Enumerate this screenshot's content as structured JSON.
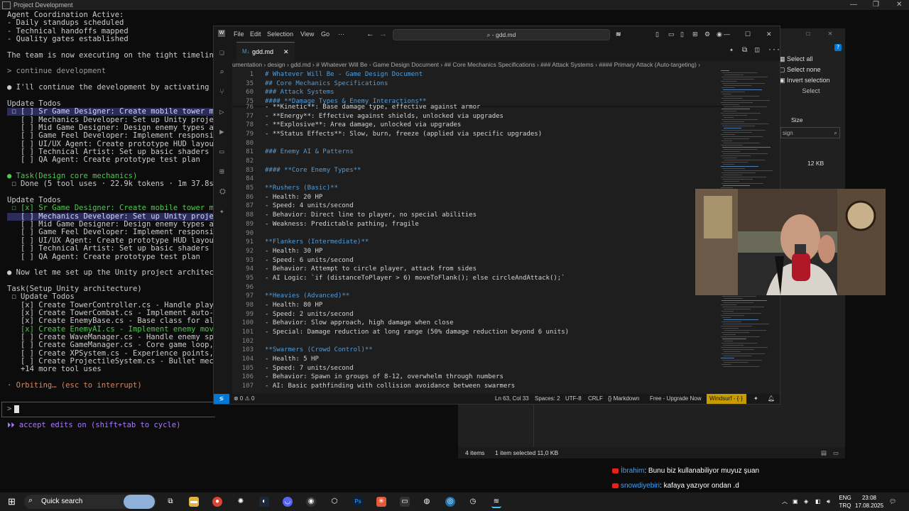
{
  "terminal": {
    "title": "Project Development",
    "lines": [
      {
        "t": "Agent Coordination Active:",
        "c": ""
      },
      {
        "t": "- Daily standups scheduled",
        "c": ""
      },
      {
        "t": "- Technical handoffs mapped",
        "c": ""
      },
      {
        "t": "- Quality gates established",
        "c": ""
      },
      {
        "t": "",
        "c": ""
      },
      {
        "t": "The team is now executing on the tight timeline with c",
        "c": ""
      },
      {
        "t": "",
        "c": ""
      },
      {
        "t": "> continue development",
        "c": "c-dim"
      },
      {
        "t": "",
        "c": ""
      },
      {
        "t": "● I'll continue the development by activating the key ag",
        "c": ""
      },
      {
        "t": "",
        "c": ""
      },
      {
        "t": "Update Todos",
        "c": ""
      },
      {
        "t": " ☐ [ ] Sr Game Designer: Create mobile tower mechanics",
        "c": "c-hl"
      },
      {
        "t": "   [ ] Mechanics Developer: Set up Unity project archi",
        "c": ""
      },
      {
        "t": "   [ ] Mid Game Designer: Design enemy types and wave ",
        "c": ""
      },
      {
        "t": "   [ ] Game Feel Developer: Implement responsive tower",
        "c": ""
      },
      {
        "t": "   [ ] UI/UX Agent: Create prototype HUD layout",
        "c": ""
      },
      {
        "t": "   [ ] Technical Artist: Set up basic shaders and visu",
        "c": ""
      },
      {
        "t": "   [ ] QA Agent: Create prototype test plan",
        "c": ""
      },
      {
        "t": "",
        "c": ""
      },
      {
        "t": "● Task(Design core mechanics)",
        "c": "c-green"
      },
      {
        "t": " ☐ Done (5 tool uses · 22.9k tokens · 1m 37.8s)",
        "c": ""
      },
      {
        "t": "",
        "c": ""
      },
      {
        "t": "Update Todos",
        "c": ""
      },
      {
        "t": " ☐ [x] Sr Game Designer: Create mobile tower mechanics",
        "c": "c-green"
      },
      {
        "t": "   [ ] Mechanics Developer: Set up Unity project archi",
        "c": "c-hl"
      },
      {
        "t": "   [ ] Mid Game Designer: Design enemy types and wave ",
        "c": ""
      },
      {
        "t": "   [ ] Game Feel Developer: Implement responsive tower",
        "c": ""
      },
      {
        "t": "   [ ] UI/UX Agent: Create prototype HUD layout",
        "c": ""
      },
      {
        "t": "   [ ] Technical Artist: Set up basic shaders and visu",
        "c": ""
      },
      {
        "t": "   [ ] QA Agent: Create prototype test plan",
        "c": ""
      },
      {
        "t": "",
        "c": ""
      },
      {
        "t": "● Now let me set up the Unity project architecture:",
        "c": ""
      },
      {
        "t": "",
        "c": ""
      },
      {
        "t": "Task(Setup Unity architecture)",
        "c": ""
      },
      {
        "t": " ☐ Update Todos",
        "c": ""
      },
      {
        "t": "   [x] Create TowerController.cs - Handle player movem",
        "c": ""
      },
      {
        "t": "   [x] Create TowerCombat.cs - Implement auto-targetin",
        "c": ""
      },
      {
        "t": "   [x] Create EnemyBase.cs - Base class for all enemy ",
        "c": ""
      },
      {
        "t": "   [x] Create EnemyAI.cs - Implement enemy movement pa",
        "c": "c-green"
      },
      {
        "t": "   [ ] Create WaveManager.cs - Handle enemy spawning, ",
        "c": ""
      },
      {
        "t": "   [ ] Create GameManager.cs - Core game loop, state m",
        "c": ""
      },
      {
        "t": "   [ ] Create XPSystem.cs - Experience points, levelin",
        "c": ""
      },
      {
        "t": "   [ ] Create ProjectileSystem.cs - Bullet mechanics, ",
        "c": ""
      },
      {
        "t": "   +14 more tool uses",
        "c": ""
      },
      {
        "t": "",
        "c": ""
      },
      {
        "t": "· Orbiting… (esc to interrupt)",
        "c": "c-orange"
      }
    ],
    "prompt_symbol": ">",
    "footer": "⏵⏵ accept edits on (shift+tab to cycle)"
  },
  "explorer": {
    "ribbon": [
      "Select all",
      "Select none",
      "Invert selection"
    ],
    "ribbon_group": "Select",
    "search_placeholder": "sign",
    "column": "Size",
    "file_size": "12 KB",
    "status_left": "4 items",
    "status_mid": "1 item selected  11,0 KB"
  },
  "vscode": {
    "menus": [
      "File",
      "Edit",
      "Selection",
      "View",
      "Go",
      "···"
    ],
    "search": "⌕ - gdd.md",
    "tab": "gdd.md",
    "breadcrumb": "umentation › design › gdd.md › # Whatever Will Be - Game Design Document › ## Core Mechanics Specifications › ### Attack Systems › #### Primary Attack (Auto-targeting) ›",
    "sticky": [
      {
        "n": "1",
        "t": "# Whatever Will Be - Game Design Document",
        "k": "md-h"
      },
      {
        "n": "35",
        "t": "## Core Mechanics Specifications",
        "k": "md-h"
      },
      {
        "n": "60",
        "t": "### Attack Systems",
        "k": "md-h"
      },
      {
        "n": "75",
        "t": "#### **Damage Types & Enemy Interactions**",
        "k": "md-h"
      }
    ],
    "lines": [
      {
        "n": "76",
        "t": "- **Kinetic**: Base damage type, effective against armor",
        "k": ""
      },
      {
        "n": "77",
        "t": "- **Energy**: Effective against shields, unlocked via upgrades",
        "k": ""
      },
      {
        "n": "78",
        "t": "- **Explosive**: Area damage, unlocked via upgrades",
        "k": ""
      },
      {
        "n": "79",
        "t": "- **Status Effects**: Slow, burn, freeze (applied via specific upgrades)",
        "k": ""
      },
      {
        "n": "80",
        "t": "",
        "k": ""
      },
      {
        "n": "81",
        "t": "### Enemy AI & Patterns",
        "k": "md-h"
      },
      {
        "n": "82",
        "t": "",
        "k": ""
      },
      {
        "n": "83",
        "t": "#### **Core Enemy Types**",
        "k": "md-h"
      },
      {
        "n": "84",
        "t": "",
        "k": ""
      },
      {
        "n": "85",
        "t": "**Rushers (Basic)**",
        "k": "md-b"
      },
      {
        "n": "86",
        "t": "- Health: 20 HP",
        "k": ""
      },
      {
        "n": "87",
        "t": "- Speed: 4 units/second",
        "k": ""
      },
      {
        "n": "88",
        "t": "- Behavior: Direct line to player, no special abilities",
        "k": ""
      },
      {
        "n": "89",
        "t": "- Weakness: Predictable pathing, fragile",
        "k": ""
      },
      {
        "n": "90",
        "t": "",
        "k": ""
      },
      {
        "n": "91",
        "t": "**Flankers (Intermediate)**",
        "k": "md-b"
      },
      {
        "n": "92",
        "t": "- Health: 30 HP",
        "k": ""
      },
      {
        "n": "93",
        "t": "- Speed: 6 units/second",
        "k": ""
      },
      {
        "n": "94",
        "t": "- Behavior: Attempt to circle player, attack from sides",
        "k": ""
      },
      {
        "n": "95",
        "t": "- AI Logic: `if (distanceToPlayer > 6) moveToFlank(); else circleAndAttack();`",
        "k": ""
      },
      {
        "n": "96",
        "t": "",
        "k": ""
      },
      {
        "n": "97",
        "t": "**Heavies (Advanced)**",
        "k": "md-b"
      },
      {
        "n": "98",
        "t": "- Health: 80 HP",
        "k": ""
      },
      {
        "n": "99",
        "t": "- Speed: 2 units/second",
        "k": ""
      },
      {
        "n": "100",
        "t": "- Behavior: Slow approach, high damage when close",
        "k": ""
      },
      {
        "n": "101",
        "t": "- Special: Damage reduction at long range (50% damage reduction beyond 6 units)",
        "k": ""
      },
      {
        "n": "102",
        "t": "",
        "k": ""
      },
      {
        "n": "103",
        "t": "**Swarmers (Crowd Control)**",
        "k": "md-b"
      },
      {
        "n": "104",
        "t": "- Health: 5 HP",
        "k": ""
      },
      {
        "n": "105",
        "t": "- Speed: 7 units/second",
        "k": ""
      },
      {
        "n": "106",
        "t": "- Behavior: Spawn in groups of 8-12, overwhelm through numbers",
        "k": ""
      },
      {
        "n": "107",
        "t": "- AI: Basic pathfinding with collision avoidance between swarmers",
        "k": ""
      }
    ],
    "status": {
      "errors": "⊗ 0 ⚠ 0",
      "position": "Ln 63, Col 33",
      "spaces": "Spaces: 2",
      "encoding": "UTF-8",
      "eol": "CRLF",
      "language": "{} Markdown",
      "plan": "Free - Upgrade Now",
      "windsurf": "Windsurf - {·}"
    }
  },
  "chat": [
    {
      "user": "İbrahim",
      "msg": "Bunu biz kullanabiliyor muyuz şuan"
    },
    {
      "user": "snowdiyebiri",
      "msg": "kafaya yazıyor ondan .d"
    }
  ],
  "taskbar": {
    "search": "Quick search",
    "lang": "ENG",
    "layout": "TRQ",
    "time": "23:08",
    "date": "17.08.2025"
  },
  "colors": {
    "accent": "#0078d4",
    "windsurf": "#c69c00",
    "heading": "#569cd6"
  }
}
